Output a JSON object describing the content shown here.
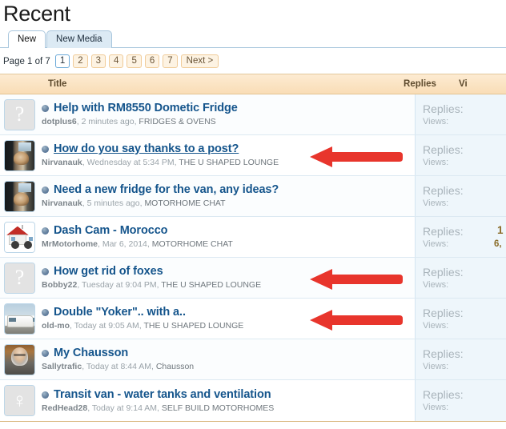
{
  "page": {
    "title": "Recent"
  },
  "tabs": [
    {
      "label": "New",
      "active": true
    },
    {
      "label": "New Media",
      "active": false
    }
  ],
  "pagination": {
    "label": "Page 1 of 7",
    "pages": [
      "1",
      "2",
      "3",
      "4",
      "5",
      "6",
      "7"
    ],
    "current": "1",
    "next_label": "Next >"
  },
  "table": {
    "headers": {
      "title": "Title",
      "replies": "Replies",
      "views": "Vi"
    },
    "rows": [
      {
        "avatar": "question-mark-avatar",
        "title": "Help with RM8550 Dometic Fridge",
        "visited": false,
        "user": "dotplus6",
        "time": "2 minutes ago",
        "forum": "FRIDGES & OVENS",
        "replies_label": "Replies:",
        "views_label": "Views:",
        "replies_value": "",
        "views_value": "",
        "arrow": false
      },
      {
        "avatar": "dog-in-car-avatar",
        "title": "How do you say thanks to a post?",
        "visited": true,
        "user": "Nirvanauk",
        "time": "Wednesday at 5:34 PM",
        "forum": "THE U SHAPED LOUNGE",
        "replies_label": "Replies:",
        "views_label": "Views:",
        "replies_value": "",
        "views_value": "",
        "arrow": true
      },
      {
        "avatar": "dog-in-car-avatar",
        "title": "Need a new fridge for the van, any ideas?",
        "visited": false,
        "user": "Nirvanauk",
        "time": "5 minutes ago",
        "forum": "MOTORHOME CHAT",
        "replies_label": "Replies:",
        "views_label": "Views:",
        "replies_value": "",
        "views_value": "",
        "arrow": false
      },
      {
        "avatar": "tiny-house-avatar",
        "title": "Dash Cam - Morocco",
        "visited": false,
        "user": "MrMotorhome",
        "time": "Mar 6, 2014",
        "forum": "MOTORHOME CHAT",
        "replies_label": "Replies:",
        "views_label": "Views:",
        "replies_value": "1",
        "views_value": "6,",
        "arrow": false
      },
      {
        "avatar": "question-mark-avatar",
        "title": "How get rid of foxes",
        "visited": false,
        "user": "Bobby22",
        "time": "Tuesday at 9:04 PM",
        "forum": "THE U SHAPED LOUNGE",
        "replies_label": "Replies:",
        "views_label": "Views:",
        "replies_value": "",
        "views_value": "",
        "arrow": true
      },
      {
        "avatar": "motorhome-avatar",
        "title": "Double \"Yoker\".. with a..",
        "visited": false,
        "user": "old-mo",
        "time": "Today at 9:05 AM",
        "forum": "THE U SHAPED LOUNGE",
        "replies_label": "Replies:",
        "views_label": "Views:",
        "replies_value": "",
        "views_value": "",
        "arrow": true
      },
      {
        "avatar": "bearded-man-avatar",
        "title": "My Chausson",
        "visited": false,
        "user": "Sallytrafic",
        "time": "Today at 8:44 AM",
        "forum": "Chausson",
        "replies_label": "Replies:",
        "views_label": "Views:",
        "replies_value": "",
        "views_value": "",
        "arrow": false
      },
      {
        "avatar": "female-symbol-avatar",
        "title": "Transit van - water tanks and ventilation",
        "visited": false,
        "user": "RedHead28",
        "time": "Today at 9:14 AM",
        "forum": "SELF BUILD MOTORHOMES",
        "replies_label": "Replies:",
        "views_label": "Views:",
        "replies_value": "",
        "views_value": "",
        "arrow": false
      }
    ]
  },
  "colors": {
    "header_gradient_top": "#fdebd2",
    "header_gradient_bottom": "#f9ddb6",
    "link_blue": "#15558c",
    "stats_bg": "#eef6fb",
    "arrow_red": "#e8352c",
    "tab_active_bg": "#ffffff",
    "tab_inactive_bg": "#dceaf4"
  }
}
